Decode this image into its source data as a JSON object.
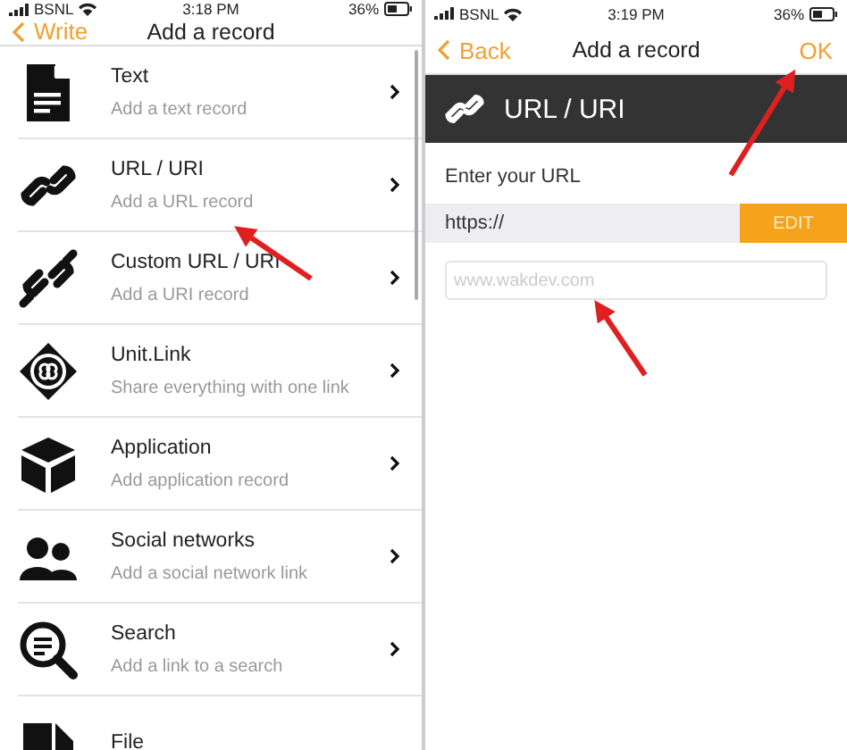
{
  "left_screen": {
    "status_bar": {
      "carrier": "BSNL",
      "time": "3:18 PM",
      "battery": "36%"
    },
    "nav": {
      "back": "Write",
      "title": "Add a record"
    },
    "records": [
      {
        "kind": "text",
        "title": "Text",
        "subtitle": "Add a text record"
      },
      {
        "kind": "url",
        "title": "URL / URI",
        "subtitle": "Add a URL record"
      },
      {
        "kind": "custom_url",
        "title": "Custom URL / URI",
        "subtitle": "Add a URI record"
      },
      {
        "kind": "unit_link",
        "title": "Unit.Link",
        "subtitle": "Share everything with one link"
      },
      {
        "kind": "application",
        "title": "Application",
        "subtitle": "Add application record"
      },
      {
        "kind": "social",
        "title": "Social networks",
        "subtitle": "Add a social network link"
      },
      {
        "kind": "search",
        "title": "Search",
        "subtitle": "Add a link to a search"
      },
      {
        "kind": "file",
        "title": "File"
      }
    ]
  },
  "right_screen": {
    "status_bar": {
      "carrier": "BSNL",
      "time": "3:19 PM",
      "battery": "36%"
    },
    "nav": {
      "back": "Back",
      "title": "Add a record",
      "action": "OK"
    },
    "header": {
      "title": "URL / URI"
    },
    "url_label": "Enter your URL",
    "url_prefix": "https://",
    "edit_button": "EDIT",
    "url_field": {
      "placeholder": "www.wakdev.com"
    }
  }
}
